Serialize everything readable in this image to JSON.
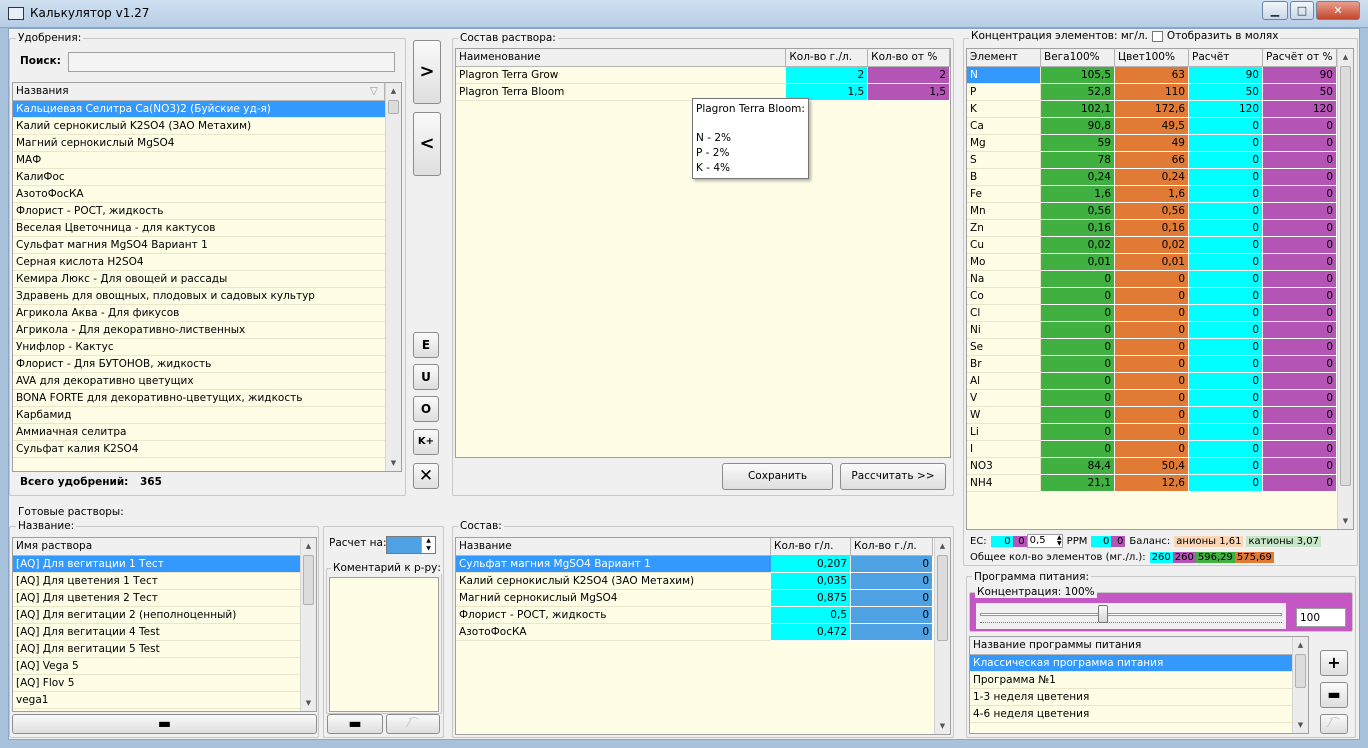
{
  "window": {
    "title": "Калькулятор v1.27",
    "min": "▁",
    "max": "□",
    "close": "✕"
  },
  "fertilizers": {
    "group_label": "Удобрения:",
    "search_label": "Поиск:",
    "search_value": "",
    "column": "Названия",
    "items": [
      "Кальциевая Селитра Ca(NO3)2 (Буйские уд-я)",
      "Калий сернокислый K2SO4 (ЗАО Метахим)",
      "Магний сернокислый MgSO4",
      "МАФ",
      "КалиФос",
      "АзотоФосКА",
      "Флорист - РОСТ, жидкость",
      "Веселая Цветочница - для кактусов",
      "Сульфат магния MgSO4 Вариант 1",
      "Серная кислота H2SO4",
      "Кемира Люкс - Для овощей и рассады",
      "Здравень для овощных, плодовых и садовых культур",
      "Агрикола Аква - Для фикусов",
      "Агрикола - Для декоративно-лиственных",
      "Унифлор - Кактус",
      "Флорист - Для БУТОНОВ, жидкость",
      "AVA для декоративно цветущих",
      "BONA FORTE для декоративно-цветущих, жидкость",
      "Карбамид",
      "Аммиачная селитра",
      "Сульфат калия K2SO4"
    ],
    "total_label": "Всего удобрений:",
    "total_value": "365"
  },
  "middle_buttons": {
    "add": ">",
    "remove": "<",
    "e": "E",
    "u": "U",
    "o": "O",
    "kplus": "K+",
    "clear": "✕"
  },
  "solution": {
    "group_label": "Состав раствора:",
    "columns": [
      "Наименование",
      "Кол-во г./л.",
      "Кол-во от %"
    ],
    "rows": [
      {
        "name": "Plagron Terra Grow",
        "qty": "2",
        "pct": "2"
      },
      {
        "name": "Plagron Terra Bloom",
        "qty": "1,5",
        "pct": "1,5"
      }
    ],
    "tooltip": {
      "title": "Plagron Terra Bloom:",
      "lines": [
        "N - 2%",
        "P - 2%",
        "K - 4%"
      ]
    },
    "save_label": "Сохранить",
    "calc_label": "Рассчитать >>"
  },
  "elements": {
    "group_label": "Концентрация элементов: мг/л.",
    "moles_label": "Отобразить в молях",
    "columns": [
      "Элемент",
      "Вега100%",
      "Цвет100%",
      "Расчёт",
      "Расчёт от %"
    ],
    "rows": [
      [
        "N",
        "105,5",
        "63",
        "90",
        "90"
      ],
      [
        "P",
        "52,8",
        "110",
        "50",
        "50"
      ],
      [
        "K",
        "102,1",
        "172,6",
        "120",
        "120"
      ],
      [
        "Ca",
        "90,8",
        "49,5",
        "0",
        "0"
      ],
      [
        "Mg",
        "59",
        "49",
        "0",
        "0"
      ],
      [
        "S",
        "78",
        "66",
        "0",
        "0"
      ],
      [
        "B",
        "0,24",
        "0,24",
        "0",
        "0"
      ],
      [
        "Fe",
        "1,6",
        "1,6",
        "0",
        "0"
      ],
      [
        "Mn",
        "0,56",
        "0,56",
        "0",
        "0"
      ],
      [
        "Zn",
        "0,16",
        "0,16",
        "0",
        "0"
      ],
      [
        "Cu",
        "0,02",
        "0,02",
        "0",
        "0"
      ],
      [
        "Mo",
        "0,01",
        "0,01",
        "0",
        "0"
      ],
      [
        "Na",
        "0",
        "0",
        "0",
        "0"
      ],
      [
        "Co",
        "0",
        "0",
        "0",
        "0"
      ],
      [
        "Cl",
        "0",
        "0",
        "0",
        "0"
      ],
      [
        "Ni",
        "0",
        "0",
        "0",
        "0"
      ],
      [
        "Se",
        "0",
        "0",
        "0",
        "0"
      ],
      [
        "Br",
        "0",
        "0",
        "0",
        "0"
      ],
      [
        "Al",
        "0",
        "0",
        "0",
        "0"
      ],
      [
        "V",
        "0",
        "0",
        "0",
        "0"
      ],
      [
        "W",
        "0",
        "0",
        "0",
        "0"
      ],
      [
        "Li",
        "0",
        "0",
        "0",
        "0"
      ],
      [
        "I",
        "0",
        "0",
        "0",
        "0"
      ],
      [
        "NO3",
        "84,4",
        "50,4",
        "0",
        "0"
      ],
      [
        "NH4",
        "21,1",
        "12,6",
        "0",
        "0"
      ]
    ],
    "ec_label": "EC:",
    "ec_a": "0",
    "ec_b": "0",
    "ec_c": "0,5",
    "ppm_label": "PPM",
    "ppm_a": "0",
    "ppm_b": "0",
    "balance_label": "Баланс:",
    "anions": "анионы 1,61",
    "cations": "катионы 3,07",
    "total_label": "Общее кол-во элементов (мг./л.):",
    "total_values": [
      "260",
      "260",
      "596,29",
      "575,69"
    ]
  },
  "ready": {
    "group_label": "Готовые растворы:",
    "name_label": "Название:",
    "column": "Имя раствора",
    "items": [
      "[AQ] Для вегитации 1 Тест",
      "[AQ] Для цветения 1 Тест",
      "[AQ] Для цветения 2 Тест",
      "[AQ] Для вегитации 2 (неполноценный)",
      "[AQ] Для вегитации 4 Test",
      "[AQ] Для вегитации 5 Test",
      "[AQ] Vega 5",
      "[AQ] Flov 5",
      "vega1"
    ],
    "minus": "▬",
    "calc_for_label": "Расчет на:",
    "comment_label": "Коментарий к р-ру:",
    "comment_minus": "▬"
  },
  "composition": {
    "group_label": "Состав:",
    "columns": [
      "Название",
      "Кол-во г/л.",
      "Кол-во г./л."
    ],
    "rows": [
      {
        "name": "Сульфат магния MgSO4 Вариант 1",
        "a": "0,207",
        "b": "0"
      },
      {
        "name": "Калий сернокислый K2SO4 (ЗАО Метахим)",
        "a": "0,035",
        "b": "0"
      },
      {
        "name": "Магний сернокислый MgSO4",
        "a": "0,875",
        "b": "0"
      },
      {
        "name": "Флорист - РОСТ, жидкость",
        "a": "0,5",
        "b": "0"
      },
      {
        "name": "АзотоФосКА",
        "a": "0,472",
        "b": "0"
      }
    ]
  },
  "program": {
    "group_label": "Программа питания:",
    "concentration_label": "Концентрация: 100%",
    "slider_value": 1.0,
    "value": "100",
    "column": "Название программы питания",
    "items": [
      "Классическая программа питания",
      "Программа №1",
      "1-3 неделя цветения",
      "4-6 неделя цветения"
    ],
    "plus": "+",
    "minus": "▬"
  }
}
